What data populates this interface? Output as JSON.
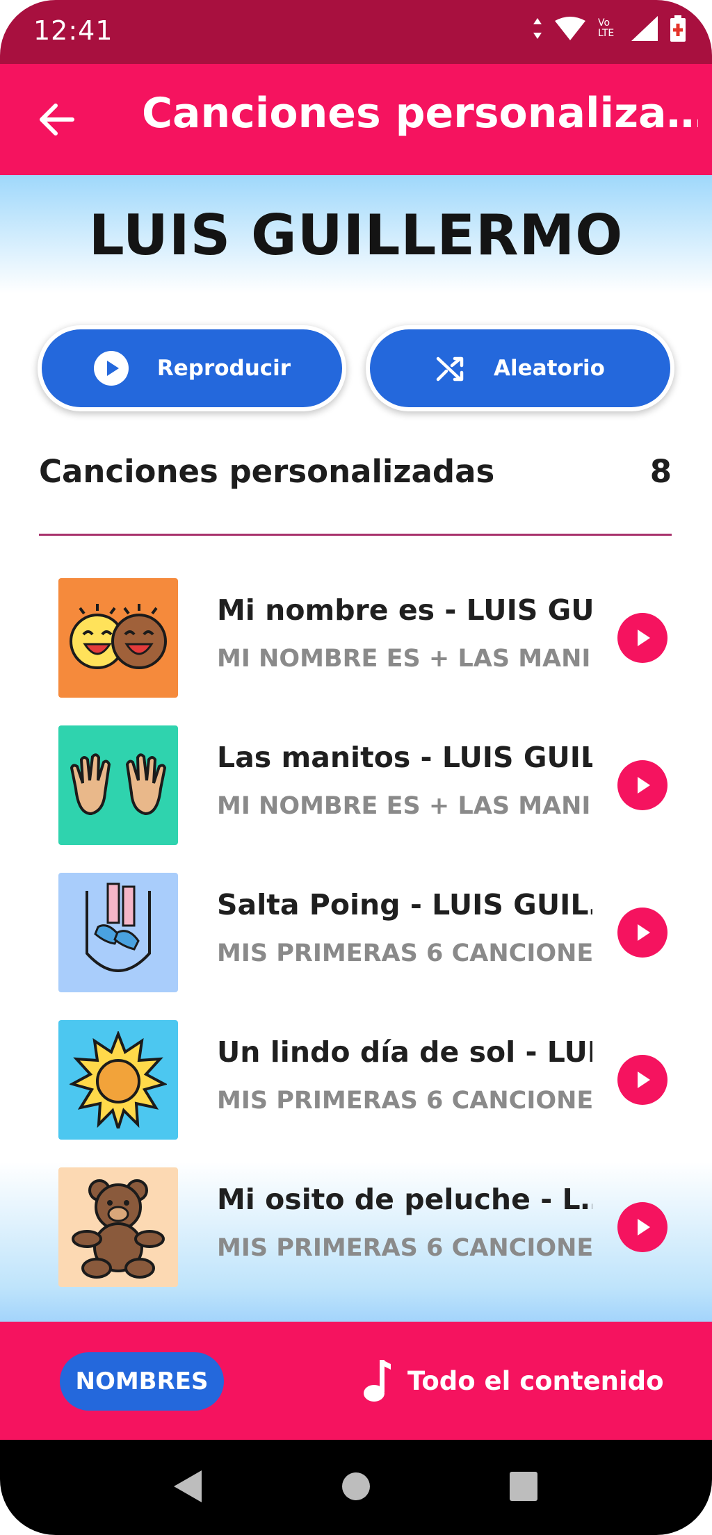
{
  "status_bar": {
    "time": "12:41",
    "network_label": "Vo LTE"
  },
  "app_bar": {
    "title": "Canciones personaliza…"
  },
  "profile": {
    "name": "LUIS GUILLERMO"
  },
  "actions": {
    "play_label": "Reproducir",
    "shuffle_label": "Aleatorio"
  },
  "section": {
    "title": "Canciones personalizadas",
    "count": "8"
  },
  "songs": [
    {
      "title": "Mi nombre es - LUIS GU…",
      "subtitle": "MI NOMBRE ES + LAS MANI…",
      "thumb_color": "#f58a3c",
      "icon": "laughing-faces-icon"
    },
    {
      "title": "Las manitos - LUIS GUIL…",
      "subtitle": "MI NOMBRE ES + LAS MANI…",
      "thumb_color": "#2fd3ae",
      "icon": "hands-icon"
    },
    {
      "title": "Salta Poing - LUIS GUIL…",
      "subtitle": "MIS PRIMERAS 6 CANCIONE…",
      "thumb_color": "#a9cdfb",
      "icon": "jumping-feet-icon"
    },
    {
      "title": "Un lindo día de sol - LUI…",
      "subtitle": "MIS PRIMERAS 6 CANCIONE…",
      "thumb_color": "#4cc7f0",
      "icon": "sun-icon"
    },
    {
      "title": "Mi osito de peluche - L…",
      "subtitle": "MIS PRIMERAS 6 CANCIONE…",
      "thumb_color": "#fcd9b3",
      "icon": "teddy-bear-icon"
    }
  ],
  "bottom_nav": {
    "names_label": "NOMBRES",
    "all_content_label": "Todo el contenido"
  },
  "colors": {
    "primary": "#f5135f",
    "status_bar": "#a8103f",
    "accent_blue": "#2468dc"
  }
}
